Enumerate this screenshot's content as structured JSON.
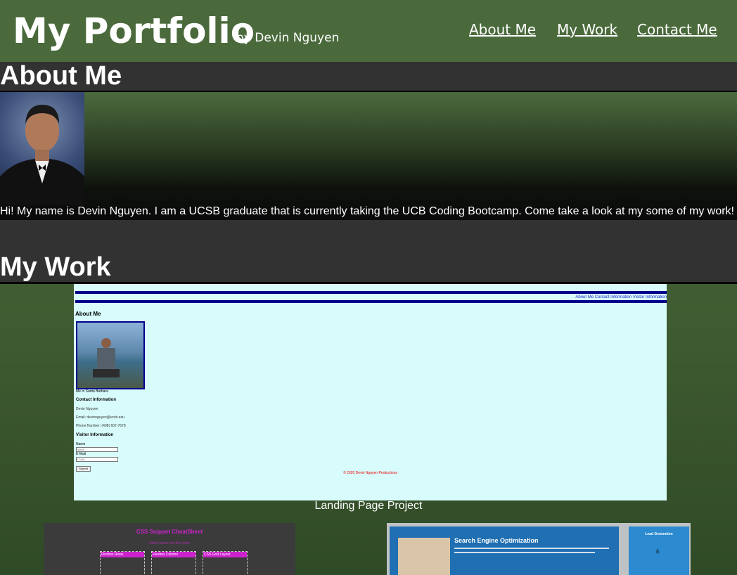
{
  "header": {
    "title": "My Portfolio",
    "byline": "by Devin Nguyen",
    "nav": [
      "About Me",
      "My Work",
      "Contact Me"
    ]
  },
  "about": {
    "heading": "About Me",
    "text": "Hi! My name is Devin Nguyen. I am a UCSB graduate that is currently taking the UCB Coding Bootcamp. Come take a look at my some of my work!"
  },
  "work": {
    "heading": "My Work",
    "projects": [
      {
        "caption": "Landing Page Project"
      },
      {
        "title": "CSS Snippet CheatSheet"
      },
      {
        "title": "Search Engine Optimization",
        "side_title": "Lead Generation"
      }
    ]
  },
  "landing_preview": {
    "nav_links": "About Me Contact Information Visitor Information",
    "about_heading": "About Me",
    "photo_caption": "Me in Santa Barbara",
    "contact_heading": "Contact Information",
    "name": "Devin Nguyen",
    "email": "Email: devinnguyen@ucsb.edu",
    "phone": "Phone Number: (408) 607-7678",
    "visitor_heading": "Visitor Information",
    "name_label": "Name",
    "name_placeholder": "Name",
    "email_label": "E-Mail",
    "email_placeholder": "E-Mail",
    "submit": "Submit",
    "footer": "© 2020 Devin Nguyen Productions"
  },
  "css_preview": {
    "subtitle": "Listed below are the notes",
    "boxes": [
      "Flexbox Rows",
      "Flexbox Column",
      "CSS Grid Layout"
    ]
  },
  "colors": {
    "header_bg": "#4a6a3c",
    "section_bar": "#323232",
    "preview_bg": "#d8fcfc",
    "preview_nav": "#00008b"
  }
}
